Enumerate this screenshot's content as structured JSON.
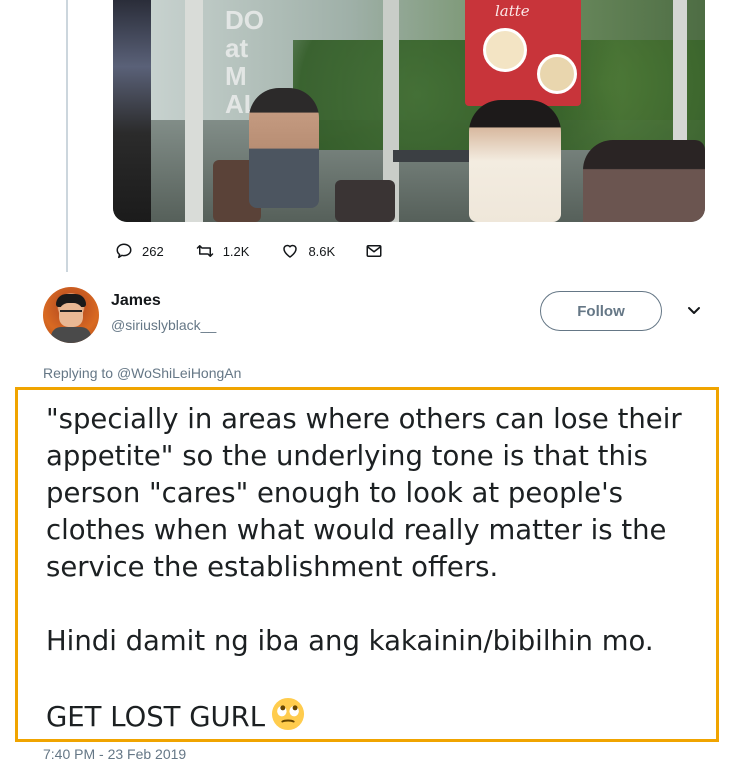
{
  "media": {
    "photo_text": [
      "DO",
      "at",
      "M",
      "ALL"
    ],
    "poster_text": "latte"
  },
  "actions": {
    "replies": "262",
    "retweets": "1.2K",
    "likes": "8.6K",
    "icons": [
      "reply-icon",
      "retweet-icon",
      "like-icon",
      "message-icon"
    ]
  },
  "reply": {
    "display_name": "James",
    "handle": "@siriuslyblack__",
    "follow_label": "Follow",
    "replying_prefix": "Replying to",
    "replying_to": "@WoShiLeiHongAn",
    "paragraphs": [
      "\"specially in areas where others can lose their appetite\" so the underlying tone is that this person \"cares\" enough to look at people's clothes when what would really matter is the service the establishment offers.",
      "Hindi damit ng iba ang kakainin/bibilhin mo.",
      "GET LOST GURL"
    ],
    "emoji": "face-with-rolling-eyes",
    "timestamp": "7:40 PM - 23 Feb 2019"
  },
  "colors": {
    "highlight_border": "#f0a400",
    "muted_text": "#657786",
    "thread_line": "#ccd6dd"
  }
}
